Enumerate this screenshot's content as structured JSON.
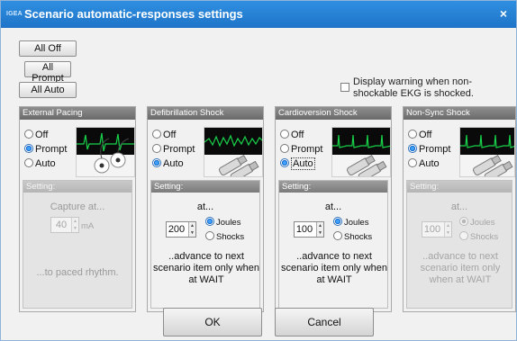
{
  "titlebar": {
    "logo": "IGEA",
    "title": "Scenario  automatic-responses settings",
    "close_glyph": "×"
  },
  "buttons": {
    "all_off": "All Off",
    "all_prompt": "All Prompt",
    "all_auto": "All Auto",
    "ok": "OK",
    "cancel": "Cancel"
  },
  "warning": {
    "checked": false,
    "label": "Display warning when non-shockable EKG is shocked."
  },
  "panels": [
    {
      "title": "External Pacing",
      "options": [
        "Off",
        "Prompt",
        "Auto"
      ],
      "selected": "Prompt",
      "thumb_icon": "pacing-pads-icon",
      "setting": {
        "enabled": false,
        "header": "Setting:",
        "line1": "Capture at...",
        "value": "40",
        "unit": "mA",
        "footer": "...to paced rhythm."
      }
    },
    {
      "title": "Defibrillation Shock",
      "options": [
        "Off",
        "Prompt",
        "Auto"
      ],
      "selected": "Auto",
      "thumb_icon": "defibrillator-paddles-icon",
      "setting": {
        "enabled": true,
        "header": "Setting:",
        "line1": "at...",
        "value": "200",
        "unit_options": [
          "Joules",
          "Shocks"
        ],
        "unit_selected": "Joules",
        "footer": "..advance to next scenario item only when at WAIT"
      }
    },
    {
      "title": "Cardioversion Shock",
      "options": [
        "Off",
        "Prompt",
        "Auto"
      ],
      "selected": "Auto",
      "thumb_icon": "defibrillator-paddles-icon",
      "setting": {
        "enabled": true,
        "header": "Setting:",
        "line1": "at...",
        "value": "100",
        "unit_options": [
          "Joules",
          "Shocks"
        ],
        "unit_selected": "Joules",
        "footer": "..advance to next scenario item only when at WAIT"
      }
    },
    {
      "title": "Non-Sync Shock",
      "options": [
        "Off",
        "Prompt",
        "Auto"
      ],
      "selected": "Prompt",
      "thumb_icon": "defibrillator-paddles-icon",
      "setting": {
        "enabled": false,
        "header": "Setting:",
        "line1": "at...",
        "value": "100",
        "unit_options": [
          "Joules",
          "Shocks"
        ],
        "unit_selected": "Joules",
        "footer": "..advance to next scenario item only when at WAIT"
      }
    }
  ],
  "colors": {
    "titlebar": "#1f74c8",
    "ekg_trace": "#19d24a",
    "ekg_background": "#0a0a0a",
    "panel_header": "#7a7a7a"
  }
}
